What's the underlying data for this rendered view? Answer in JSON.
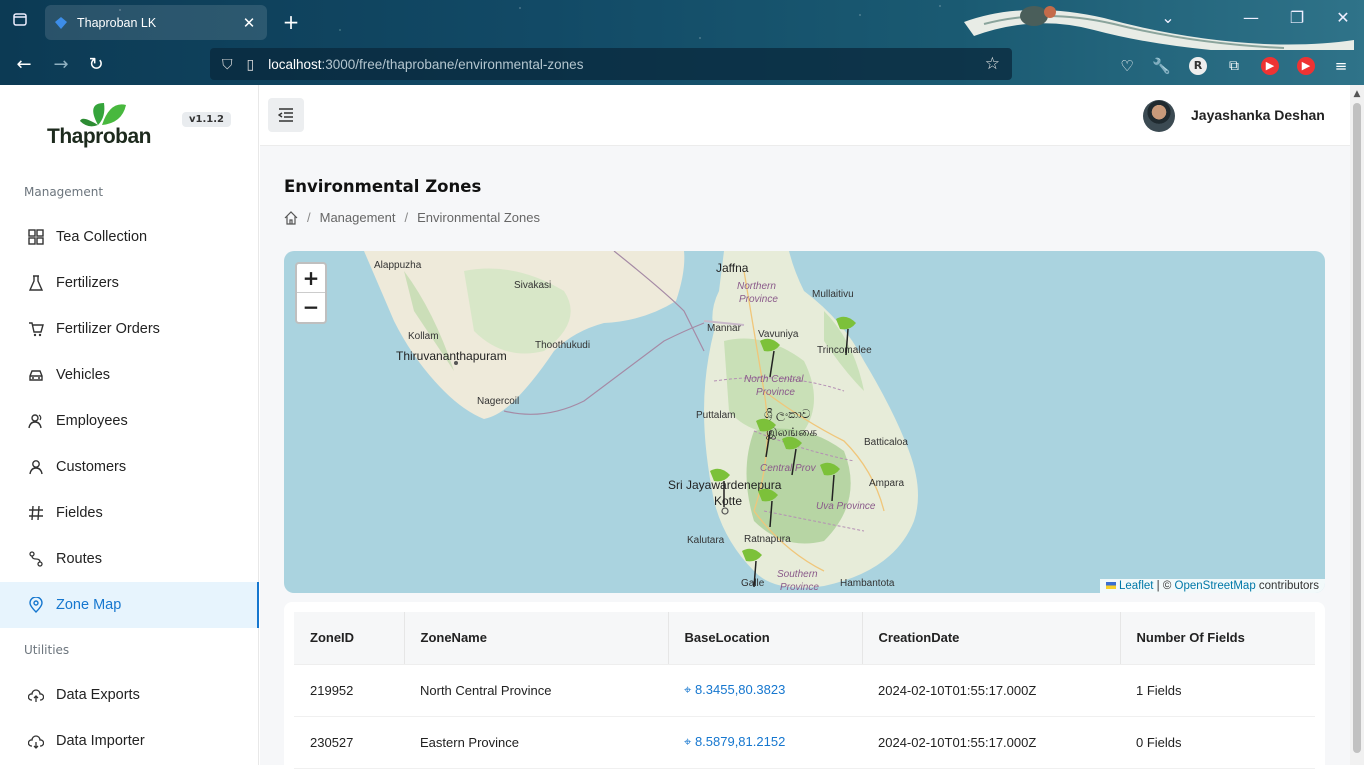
{
  "browser": {
    "tab_title": "Thaproban LK",
    "url_host": "localhost",
    "url_path": ":3000/free/thaprobane/environmental-zones"
  },
  "sidebar": {
    "logo_text": "Thaproban",
    "version": "v1.1.2",
    "section_management": "Management",
    "section_utilities": "Utilities",
    "items": [
      {
        "label": "Tea Collection",
        "icon": "grid-icon"
      },
      {
        "label": "Fertilizers",
        "icon": "flask-icon"
      },
      {
        "label": "Fertilizer Orders",
        "icon": "cart-icon"
      },
      {
        "label": "Vehicles",
        "icon": "car-icon"
      },
      {
        "label": "Employees",
        "icon": "users-icon"
      },
      {
        "label": "Customers",
        "icon": "user-icon"
      },
      {
        "label": "Fieldes",
        "icon": "hash-icon"
      },
      {
        "label": "Routes",
        "icon": "route-icon"
      },
      {
        "label": "Zone Map",
        "icon": "location-pin-icon",
        "active": true
      }
    ],
    "utilities": [
      {
        "label": "Data Exports",
        "icon": "cloud-upload-icon"
      },
      {
        "label": "Data Importer",
        "icon": "cloud-download-icon"
      }
    ]
  },
  "header": {
    "username": "Jayashanka Deshan"
  },
  "page": {
    "title": "Environmental Zones",
    "breadcrumb": [
      "Management",
      "Environmental Zones"
    ]
  },
  "map": {
    "zoom_in": "+",
    "zoom_out": "−",
    "attribution_leaflet": "Leaflet",
    "attribution_sep": " | © ",
    "attribution_osm": "OpenStreetMap",
    "attribution_tail": " contributors",
    "labels": {
      "alappuzha": "Alappuzha",
      "sivakasi": "Sivakasi",
      "kollam": "Kollam",
      "thiruvananthapuram": "Thiruvananthapuram",
      "thoothukudi": "Thoothukudi",
      "nagercoil": "Nagercoil",
      "jaffna": "Jaffna",
      "northern": "Northern",
      "province1": "Province",
      "mullaitivu": "Mullaitivu",
      "mannar": "Mannar",
      "vavuniya": "Vavuniya",
      "trincomalee": "Trincomalee",
      "north_central": "North Central",
      "province2": "Province",
      "puttalam": "Puttalam",
      "sinhala1": "ශ්‍රී ලංකාව",
      "tamil1": "இலங்கை",
      "batticaloa": "Batticaloa",
      "central_prov": "Central Prov",
      "sri_jaya": "Sri Jayawardenepura",
      "kotte": "Kotte",
      "ampara": "Ampara",
      "uva": "Uva Province",
      "kalutara": "Kalutara",
      "ratnapura": "Ratnapura",
      "southern": "Southern",
      "province3": "Province",
      "galle": "Galle",
      "hambantota": "Hambantota"
    }
  },
  "table": {
    "headers": [
      "ZoneID",
      "ZoneName",
      "BaseLocation",
      "CreationDate",
      "Number Of Fields"
    ],
    "rows": [
      {
        "id": "219952",
        "name": "North Central Province",
        "location": "8.3455,80.3823",
        "date": "2024-02-10T01:55:17.000Z",
        "fields": "1 Fields"
      },
      {
        "id": "230527",
        "name": "Eastern Province",
        "location": "8.5879,81.2152",
        "date": "2024-02-10T01:55:17.000Z",
        "fields": "0 Fields"
      }
    ]
  }
}
